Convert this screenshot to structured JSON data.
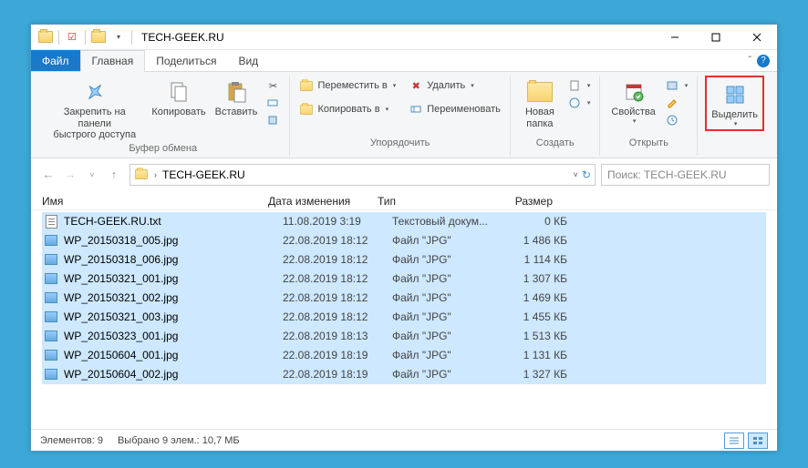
{
  "window": {
    "title": "TECH-GEEK.RU"
  },
  "menu": {
    "file": "Файл",
    "home": "Главная",
    "share": "Поделиться",
    "view": "Вид"
  },
  "ribbon": {
    "pin": "Закрепить на панели\nбыстрого доступа",
    "copy": "Копировать",
    "paste": "Вставить",
    "clipboard_label": "Буфер обмена",
    "move_to": "Переместить в",
    "copy_to": "Копировать в",
    "delete": "Удалить",
    "rename": "Переименовать",
    "organize_label": "Упорядочить",
    "new_folder": "Новая\nпапка",
    "create_label": "Создать",
    "properties": "Свойства",
    "open_label": "Открыть",
    "select": "Выделить"
  },
  "address": {
    "folder": "TECH-GEEK.RU"
  },
  "search": {
    "placeholder": "Поиск: TECH-GEEK.RU"
  },
  "columns": {
    "name": "Имя",
    "date": "Дата изменения",
    "type": "Тип",
    "size": "Размер"
  },
  "files": [
    {
      "name": "TECH-GEEK.RU.txt",
      "date": "11.08.2019 3:19",
      "type": "Текстовый докум...",
      "size": "0 КБ",
      "icon": "txt"
    },
    {
      "name": "WP_20150318_005.jpg",
      "date": "22.08.2019 18:12",
      "type": "Файл \"JPG\"",
      "size": "1 486 КБ",
      "icon": "img"
    },
    {
      "name": "WP_20150318_006.jpg",
      "date": "22.08.2019 18:12",
      "type": "Файл \"JPG\"",
      "size": "1 114 КБ",
      "icon": "img"
    },
    {
      "name": "WP_20150321_001.jpg",
      "date": "22.08.2019 18:12",
      "type": "Файл \"JPG\"",
      "size": "1 307 КБ",
      "icon": "img"
    },
    {
      "name": "WP_20150321_002.jpg",
      "date": "22.08.2019 18:12",
      "type": "Файл \"JPG\"",
      "size": "1 469 КБ",
      "icon": "img"
    },
    {
      "name": "WP_20150321_003.jpg",
      "date": "22.08.2019 18:12",
      "type": "Файл \"JPG\"",
      "size": "1 455 КБ",
      "icon": "img"
    },
    {
      "name": "WP_20150323_001.jpg",
      "date": "22.08.2019 18:13",
      "type": "Файл \"JPG\"",
      "size": "1 513 КБ",
      "icon": "img"
    },
    {
      "name": "WP_20150604_001.jpg",
      "date": "22.08.2019 18:19",
      "type": "Файл \"JPG\"",
      "size": "1 131 КБ",
      "icon": "img"
    },
    {
      "name": "WP_20150604_002.jpg",
      "date": "22.08.2019 18:19",
      "type": "Файл \"JPG\"",
      "size": "1 327 КБ",
      "icon": "img"
    }
  ],
  "status": {
    "count": "Элементов: 9",
    "selected": "Выбрано 9 элем.: 10,7 МБ"
  }
}
